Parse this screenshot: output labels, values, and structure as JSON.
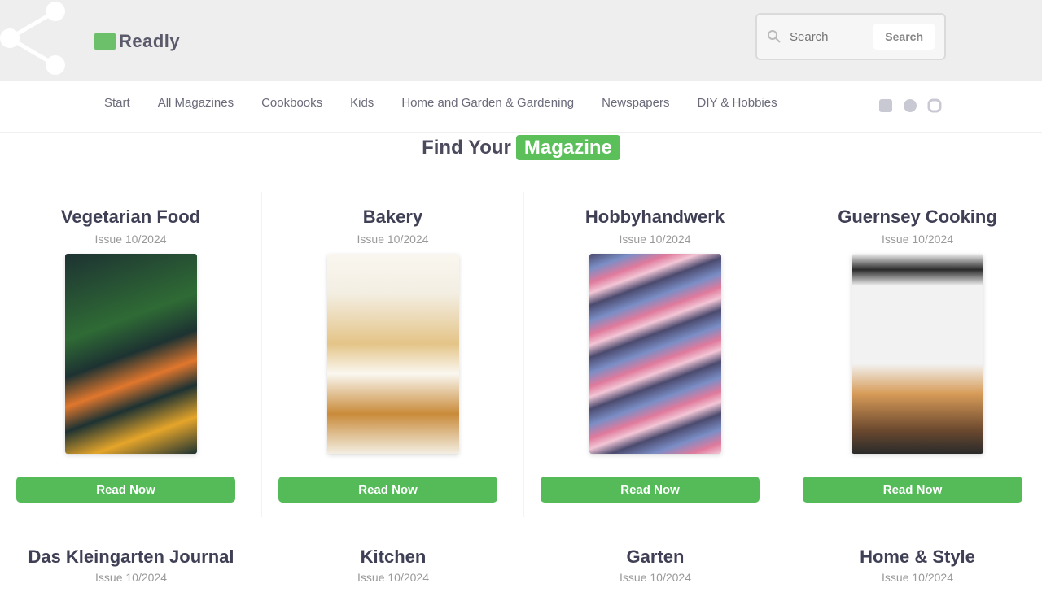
{
  "header": {
    "logo_text": "Readly",
    "search": {
      "placeholder": "Search",
      "button_label": "Search"
    }
  },
  "nav": {
    "items": [
      "Start",
      "All Magazines",
      "Cookbooks",
      "Kids",
      "Home and Garden & Gardening",
      "Newspapers",
      "DIY & Hobbies"
    ],
    "social_icons": [
      "facebook-icon",
      "twitter-icon",
      "instagram-icon"
    ]
  },
  "section_heading": {
    "part1": "Find Your",
    "part2": "Magazine"
  },
  "cards": [
    {
      "title": "Vegetarian Food",
      "subtitle": "Issue 10/2024",
      "button": "Read Now",
      "cover_colors": [
        "#1d3232",
        "#2f6b35",
        "#e0772d",
        "#e5a52a"
      ]
    },
    {
      "title": "Bakery",
      "subtitle": "Issue 10/2024",
      "button": "Read Now",
      "cover_colors": [
        "#f3eee2",
        "#e4c487",
        "#c98b3a",
        "#faf7f0"
      ]
    },
    {
      "title": "Hobbyhandwerk",
      "subtitle": "Issue 10/2024",
      "button": "Read Now",
      "cover_colors": [
        "#4b4a6e",
        "#e07a9c",
        "#7b8ec6",
        "#f2c6d6"
      ]
    },
    {
      "title": "Guernsey Cooking",
      "subtitle": "Issue 10/2024",
      "button": "Read Now",
      "cover_colors": [
        "#f2f2f2",
        "#2a2a2a",
        "#d79b58",
        "#6d4a2f"
      ]
    }
  ],
  "cards_row2": [
    {
      "title": "Das Kleingarten Journal",
      "subtitle": "Issue 10/2024"
    },
    {
      "title": "Kitchen",
      "subtitle": "Issue 10/2024"
    },
    {
      "title": "Garten",
      "subtitle": "Issue 10/2024"
    },
    {
      "title": "Home & Style",
      "subtitle": "Issue 10/2024"
    }
  ],
  "colors": {
    "accent_green": "#5bbf5a",
    "header_bg": "#eeeeee",
    "text_dark": "#3f3f55"
  }
}
